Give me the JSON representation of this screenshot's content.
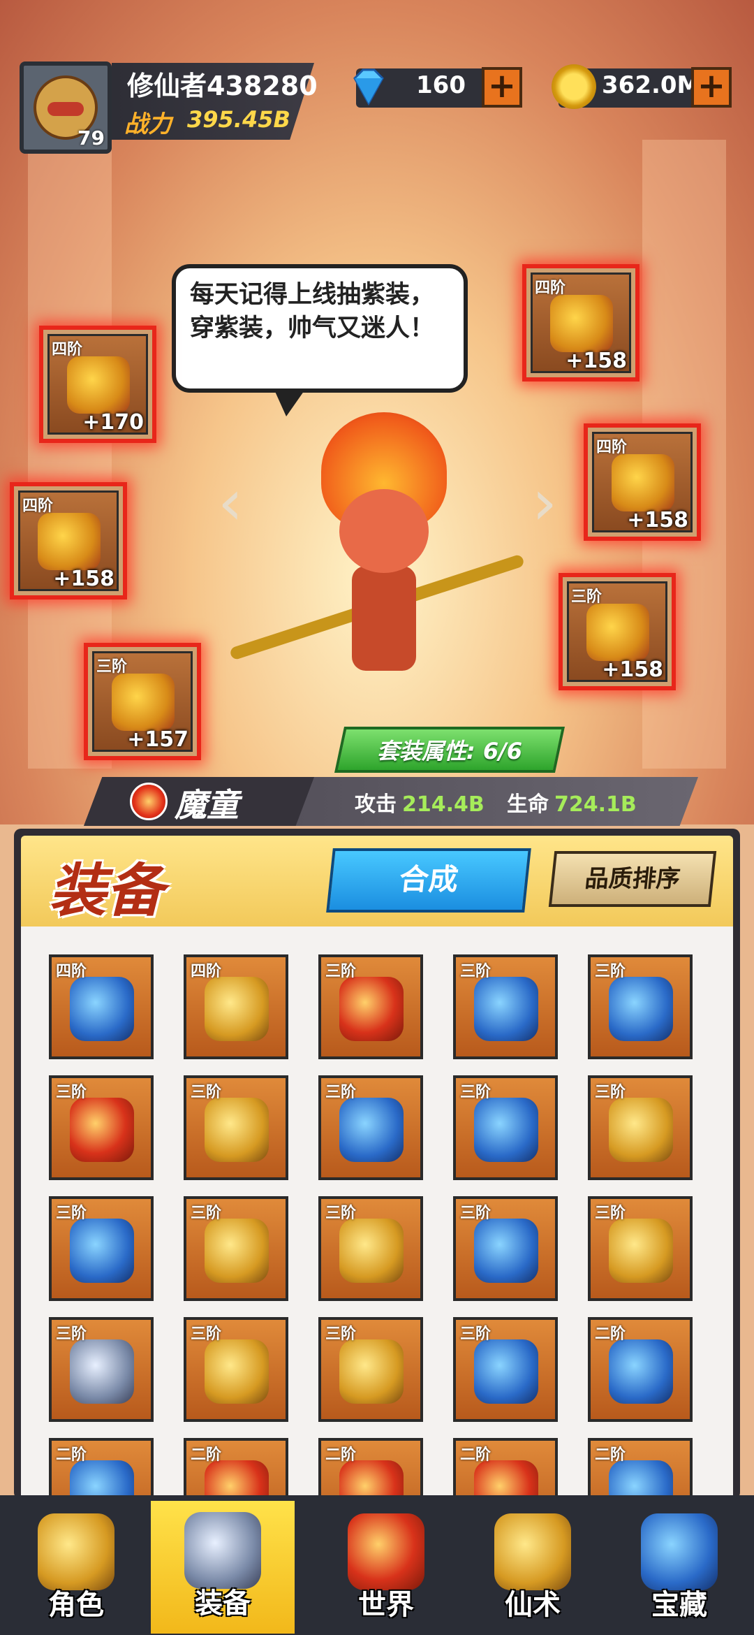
{
  "player": {
    "name": "修仙者438280",
    "level": "79",
    "power_label": "战力",
    "power_value": "395.45B"
  },
  "currency": {
    "gems": "160",
    "gold": "362.0M"
  },
  "speech": "每天记得上线抽紫装，穿紫装，帅气又迷人！",
  "equipped": [
    {
      "slot": "weapon",
      "tier": "四阶",
      "level": "+170"
    },
    {
      "slot": "boots",
      "tier": "四阶",
      "level": "+158"
    },
    {
      "slot": "ring",
      "tier": "三阶",
      "level": "+157"
    },
    {
      "slot": "helmet",
      "tier": "四阶",
      "level": "+158"
    },
    {
      "slot": "armor",
      "tier": "四阶",
      "level": "+158"
    },
    {
      "slot": "hat",
      "tier": "三阶",
      "level": "+158"
    }
  ],
  "set_bonus": "套装属性: 6/6",
  "character": {
    "name": "魔童",
    "attack_label": "攻击",
    "attack": "214.4B",
    "hp_label": "生命",
    "hp": "724.1B"
  },
  "panel": {
    "title": "装备",
    "synth_button": "合成",
    "sort_button": "品质排序"
  },
  "inventory": [
    {
      "tier": "四阶",
      "icon": "boots-blue"
    },
    {
      "tier": "四阶",
      "icon": "boots-gold"
    },
    {
      "tier": "三阶",
      "icon": "staff-red"
    },
    {
      "tier": "三阶",
      "icon": "swords-blue"
    },
    {
      "tier": "三阶",
      "icon": "swords-blue"
    },
    {
      "tier": "三阶",
      "icon": "staff-red"
    },
    {
      "tier": "三阶",
      "icon": "helmet-gold"
    },
    {
      "tier": "三阶",
      "icon": "armor-blue"
    },
    {
      "tier": "三阶",
      "icon": "armor-blue"
    },
    {
      "tier": "三阶",
      "icon": "helmet-gold"
    },
    {
      "tier": "三阶",
      "icon": "armor-blue"
    },
    {
      "tier": "三阶",
      "icon": "armor-gold"
    },
    {
      "tier": "三阶",
      "icon": "armor-gold"
    },
    {
      "tier": "三阶",
      "icon": "armor-blue"
    },
    {
      "tier": "三阶",
      "icon": "ring-gold"
    },
    {
      "tier": "三阶",
      "icon": "ring-silver"
    },
    {
      "tier": "三阶",
      "icon": "ring-gold"
    },
    {
      "tier": "三阶",
      "icon": "ring-gold"
    },
    {
      "tier": "三阶",
      "icon": "ring-blue"
    },
    {
      "tier": "二阶",
      "icon": "swords-blue"
    },
    {
      "tier": "二阶",
      "icon": "swords-blue"
    },
    {
      "tier": "二阶",
      "icon": "staff-red"
    },
    {
      "tier": "二阶",
      "icon": "staff-red"
    },
    {
      "tier": "二阶",
      "icon": "staff-red"
    },
    {
      "tier": "二阶",
      "icon": "armor-blue"
    }
  ],
  "nav": [
    {
      "label": "角色",
      "icon": "monkey-icon"
    },
    {
      "label": "装备",
      "icon": "sword-icon",
      "active": true
    },
    {
      "label": "世界",
      "icon": "pagoda-icon"
    },
    {
      "label": "仙术",
      "icon": "cauldron-icon"
    },
    {
      "label": "宝藏",
      "icon": "chest-icon"
    }
  ]
}
